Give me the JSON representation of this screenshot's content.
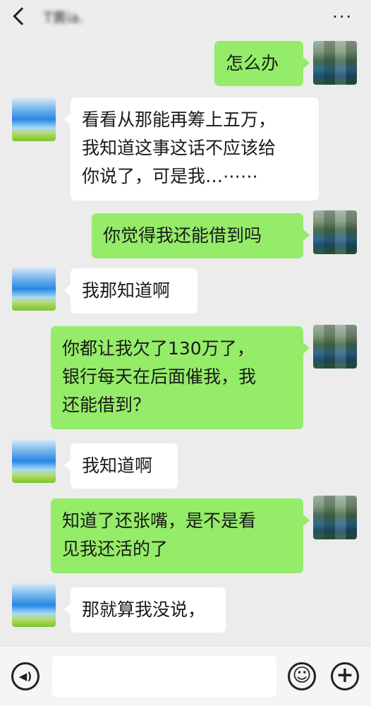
{
  "header": {
    "back_icon": "back-chevron-icon",
    "title": "T黄ia.",
    "more_label": "···"
  },
  "messages": [
    {
      "side": "right",
      "text": "怎么办"
    },
    {
      "side": "left",
      "line1": "看看从那能再筹上五万，",
      "line2": "我知道这事这话不应该给",
      "line3": "你说了，可是我…⋯⋯"
    },
    {
      "side": "right",
      "text": "你觉得我还能借到吗"
    },
    {
      "side": "left",
      "text": "我那知道啊"
    },
    {
      "side": "right",
      "line1": "你都让我欠了130万了，",
      "line2": "银行每天在后面催我，我",
      "line3": "还能借到？"
    },
    {
      "side": "left",
      "text": "我知道啊"
    },
    {
      "side": "right",
      "line1": "知道了还张嘴，是不是看",
      "line2": "见我还活的了"
    },
    {
      "side": "left",
      "text": "那就算我没说，"
    }
  ],
  "input_bar": {
    "voice_icon": "voice-icon",
    "voice_glyph": "◀)",
    "emoji_icon": "emoji-icon",
    "emoji_glyph": "☺",
    "plus_icon": "plus-icon",
    "plus_glyph": "+",
    "input_value": ""
  },
  "colors": {
    "background": "#ececec",
    "sent_bubble": "#95ec69",
    "received_bubble": "#ffffff"
  }
}
